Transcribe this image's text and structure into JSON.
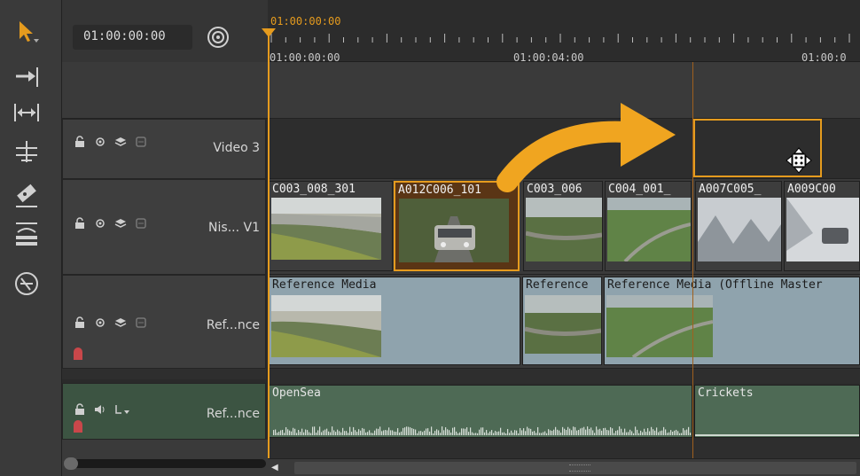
{
  "header": {
    "timecode": "01:00:00:00"
  },
  "ruler": {
    "playhead_time": "01:00:00:00",
    "labels": [
      "01:00:00:00",
      "01:00:04:00",
      "01:00:0"
    ]
  },
  "tracks": [
    {
      "name": "Video 3"
    },
    {
      "name": "Nis... V1"
    },
    {
      "name": "Ref...nce"
    },
    {
      "name": "Ref...nce"
    }
  ],
  "v1_clips": [
    "C003_008_301",
    "A012C006_101",
    "C003_006",
    "C004_001_",
    "A007C005_",
    "A009C00"
  ],
  "ref_clips": [
    "Reference Media",
    "Reference",
    "Reference Media (Offline Master"
  ],
  "audio_clips": [
    "OpenSea",
    "Crickets"
  ],
  "colors": {
    "accent": "#e59b1e",
    "ref_clip": "#8fa3ad",
    "audio_clip": "#4e6a55",
    "audio_header": "#3c5442"
  },
  "icons": [
    "select-arrow-icon",
    "track-select-icon",
    "slip-icon",
    "ripple-icon",
    "razor-icon",
    "spacer-icon",
    "zoom-icon",
    "lock-icon",
    "eye-icon",
    "layers-icon",
    "blend-icon",
    "volume-icon",
    "move-cursor-icon"
  ]
}
